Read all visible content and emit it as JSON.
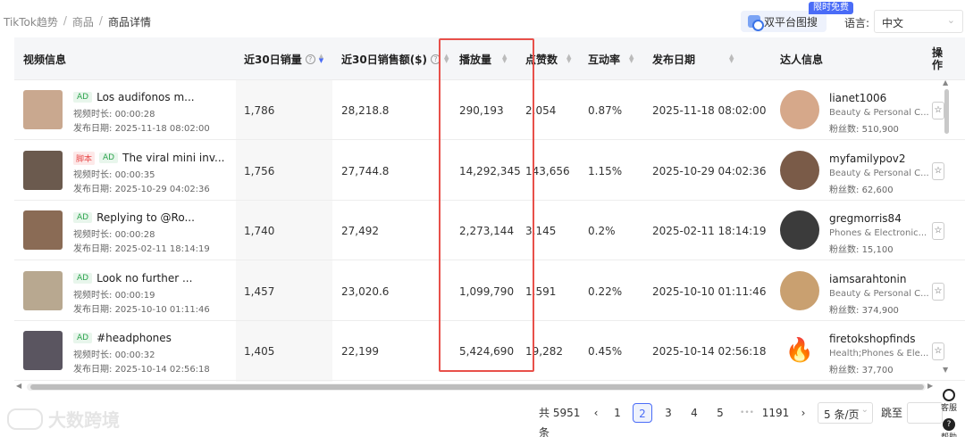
{
  "breadcrumb": [
    "TikTok趋势",
    "商品",
    "商品详情"
  ],
  "breadcrumb_sep": "/",
  "dual_platform_button": "双平台图搜",
  "free_badge": "限时免费",
  "language_label": "语言:",
  "language_value": "中文",
  "columns": {
    "video": "视频信息",
    "sales30": "近30日销量",
    "revenue30": "近30日销售额($)",
    "plays": "播放量",
    "likes": "点赞数",
    "engagement": "互动率",
    "publish_date": "发布日期",
    "creator": "达人信息",
    "op": "操作"
  },
  "meta_labels": {
    "duration": "视频时长:",
    "published": "发布日期:",
    "fans": "粉丝数:"
  },
  "rows": [
    {
      "ad": "AD",
      "script": "",
      "title": "Los audifonos m...",
      "duration": "00:00:28",
      "published": "2025-11-18 08:02:00",
      "sales30": "1,786",
      "revenue30": "28,218.8",
      "plays": "290,193",
      "likes": "2,054",
      "engagement": "0.87%",
      "publish_date": "2025-11-18 08:02:00",
      "creator": "lianet1006",
      "category": "Beauty & Personal C...",
      "fans": "510,900"
    },
    {
      "ad": "AD",
      "script": "脚本",
      "title": "The viral mini inv...",
      "duration": "00:00:35",
      "published": "2025-10-29 04:02:36",
      "sales30": "1,756",
      "revenue30": "27,744.8",
      "plays": "14,292,345",
      "likes": "143,656",
      "engagement": "1.15%",
      "publish_date": "2025-10-29 04:02:36",
      "creator": "myfamilypov2",
      "category": "Beauty & Personal C...",
      "fans": "62,600"
    },
    {
      "ad": "AD",
      "script": "",
      "title": "Replying to @Ro...",
      "duration": "00:00:28",
      "published": "2025-02-11 18:14:19",
      "sales30": "1,740",
      "revenue30": "27,492",
      "plays": "2,273,144",
      "likes": "3,145",
      "engagement": "0.2%",
      "publish_date": "2025-02-11 18:14:19",
      "creator": "gregmorris84",
      "category": "Phones & Electronic...",
      "fans": "15,100"
    },
    {
      "ad": "AD",
      "script": "",
      "title": "Look no further ...",
      "duration": "00:00:19",
      "published": "2025-10-10 01:11:46",
      "sales30": "1,457",
      "revenue30": "23,020.6",
      "plays": "1,099,790",
      "likes": "1,591",
      "engagement": "0.22%",
      "publish_date": "2025-10-10 01:11:46",
      "creator": "iamsarahtonin",
      "category": "Beauty & Personal C...",
      "fans": "374,900"
    },
    {
      "ad": "AD",
      "script": "",
      "title": "#headphones",
      "duration": "00:00:32",
      "published": "2025-10-14 02:56:18",
      "sales30": "1,405",
      "revenue30": "22,199",
      "plays": "5,424,690",
      "likes": "19,282",
      "engagement": "0.45%",
      "publish_date": "2025-10-14 02:56:18",
      "creator": "firetokshopfinds",
      "category": "Health;Phones & Ele...",
      "fans": "37,700"
    }
  ],
  "pagination": {
    "total": "共 5951 条",
    "prev": "‹",
    "pages": [
      "1",
      "2",
      "3",
      "4",
      "5"
    ],
    "active_page": "2",
    "ellipsis": "•••",
    "last": "1191",
    "next": "›",
    "page_size": "5 条/页",
    "goto_label": "跳至"
  },
  "watermark": "大数跨境",
  "side_help": {
    "service": "客服",
    "help": "帮助"
  },
  "colors": {
    "accent": "#4a6cf7",
    "highlight": "#e8504a",
    "ad_green": "#2ea44f"
  }
}
